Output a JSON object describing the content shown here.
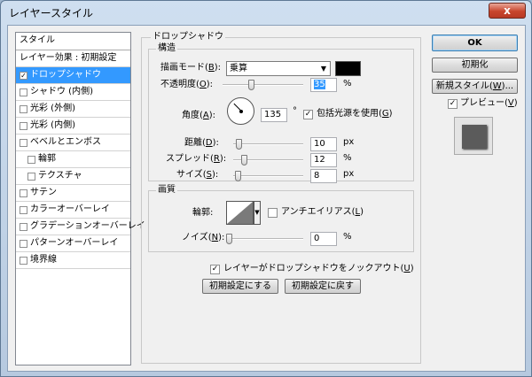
{
  "window": {
    "title": "レイヤースタイル",
    "close_glyph": "x"
  },
  "styles_panel": {
    "header": "スタイル",
    "items": [
      {
        "label": "レイヤー効果 : 初期設定",
        "checkbox": false,
        "checked": false,
        "selected": false,
        "sub": false
      },
      {
        "label": "ドロップシャドウ",
        "checkbox": true,
        "checked": true,
        "selected": true,
        "sub": false
      },
      {
        "label": "シャドウ (内側)",
        "checkbox": true,
        "checked": false,
        "selected": false,
        "sub": false
      },
      {
        "label": "光彩 (外側)",
        "checkbox": true,
        "checked": false,
        "selected": false,
        "sub": false
      },
      {
        "label": "光彩 (内側)",
        "checkbox": true,
        "checked": false,
        "selected": false,
        "sub": false
      },
      {
        "label": "ベベルとエンボス",
        "checkbox": true,
        "checked": false,
        "selected": false,
        "sub": false
      },
      {
        "label": "輪郭",
        "checkbox": true,
        "checked": false,
        "selected": false,
        "sub": true
      },
      {
        "label": "テクスチャ",
        "checkbox": true,
        "checked": false,
        "selected": false,
        "sub": true
      },
      {
        "label": "サテン",
        "checkbox": true,
        "checked": false,
        "selected": false,
        "sub": false
      },
      {
        "label": "カラーオーバーレイ",
        "checkbox": true,
        "checked": false,
        "selected": false,
        "sub": false
      },
      {
        "label": "グラデーションオーバーレイ",
        "checkbox": true,
        "checked": false,
        "selected": false,
        "sub": false
      },
      {
        "label": "パターンオーバーレイ",
        "checkbox": true,
        "checked": false,
        "selected": false,
        "sub": false
      },
      {
        "label": "境界線",
        "checkbox": true,
        "checked": false,
        "selected": false,
        "sub": false
      }
    ]
  },
  "drop_shadow": {
    "group_title": "ドロップシャドウ",
    "structure": {
      "title": "構造",
      "blend_mode": {
        "label": "描画モード",
        "key": "B",
        "value": "乗算",
        "color": "#000000"
      },
      "opacity": {
        "label": "不透明度",
        "key": "O",
        "value": "35",
        "unit": "%",
        "level": 0.35
      },
      "angle": {
        "label": "角度",
        "key": "A",
        "value": "135",
        "unit": "°",
        "degrees": 135
      },
      "global_light": {
        "label": "包括光源を使用",
        "key": "G",
        "checked": true
      },
      "distance": {
        "label": "距離",
        "key": "D",
        "value": "10",
        "unit": "px",
        "level": 0.04
      },
      "spread": {
        "label": "スプレッド",
        "key": "R",
        "value": "12",
        "unit": "%",
        "level": 0.12
      },
      "size": {
        "label": "サイズ",
        "key": "S",
        "value": "8",
        "unit": "px",
        "level": 0.03
      }
    },
    "quality": {
      "title": "画質",
      "contour": {
        "label": "輪郭",
        "anti_alias": {
          "label": "アンチエイリアス",
          "key": "L",
          "checked": false
        }
      },
      "noise": {
        "label": "ノイズ",
        "key": "N",
        "value": "0",
        "unit": "%",
        "level": 0
      }
    },
    "knockout": {
      "label": "レイヤーがドロップシャドウをノックアウト",
      "key": "U",
      "checked": true
    },
    "make_default_label": "初期設定にする",
    "reset_default_label": "初期設定に戻す"
  },
  "buttons": {
    "ok": "OK",
    "reset": "初期化",
    "new_style": {
      "label": "新規スタイル",
      "key": "W",
      "suffix": "..."
    }
  },
  "preview": {
    "label": "プレビュー",
    "key": "V",
    "checked": true
  },
  "colors": {
    "selection": "#3399ff",
    "shadow_swatch": "#000000",
    "preview_fill": "#5b5b5b"
  }
}
